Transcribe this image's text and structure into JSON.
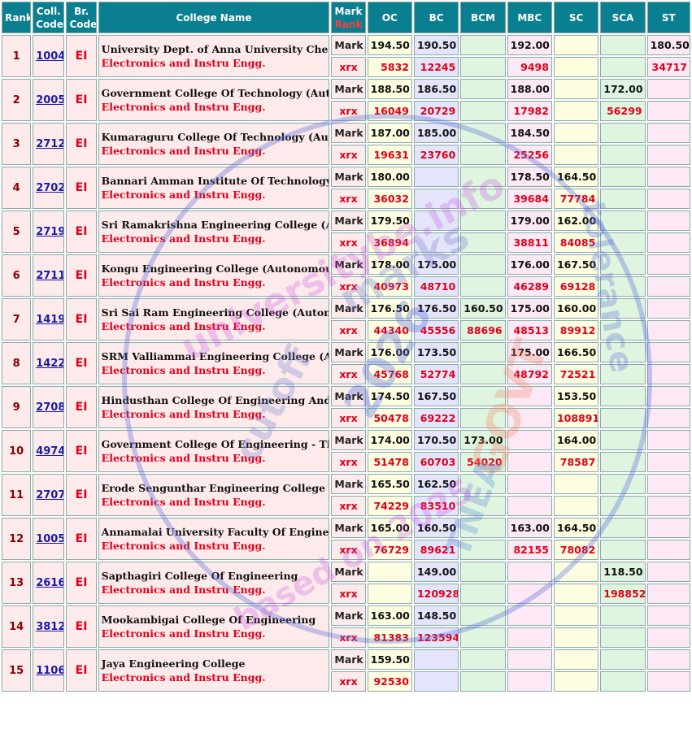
{
  "headers": {
    "rank": "Rank",
    "coll_code": "Coll. Code",
    "br_code": "Br. Code",
    "college_name": "College Name",
    "mark": "Mark",
    "mark_rank": "Rank",
    "oc": "OC",
    "bc": "BC",
    "bcm": "BCM",
    "mbc": "MBC",
    "sc": "SC",
    "sca": "SCA",
    "st": "ST"
  },
  "row_labels": {
    "mark": "Mark",
    "rank": "xrx"
  },
  "colors": {
    "header_bg": "#0a7f8f",
    "accent_red": "#e0001a",
    "link_blue": "#1a1aa8"
  },
  "watermark": {
    "line1": "universitybe.info",
    "line2": "marks",
    "line3": "cutoff",
    "line4": "2026",
    "line5": "GOVT",
    "line6": "TNEA",
    "line7": "based on 2025",
    "line8": "tolerance"
  },
  "rows": [
    {
      "rank": "1",
      "code": "1004",
      "br": "EI",
      "name": "University Dept. of Anna University Chennai - MIT Campus",
      "branch": "Electronics and Instru Engg.",
      "marks": {
        "oc": "194.50",
        "bc": "190.50",
        "bcm": "",
        "mbc": "192.00",
        "sc": "",
        "sca": "",
        "st": "180.50"
      },
      "ranks": {
        "oc": "5832",
        "bc": "12245",
        "bcm": "",
        "mbc": "9498",
        "sc": "",
        "sca": "",
        "st": "34717"
      }
    },
    {
      "rank": "2",
      "code": "2005",
      "br": "EI",
      "name": "Government College Of Technology (Autonomous)",
      "branch": "Electronics and Instru Engg.",
      "marks": {
        "oc": "188.50",
        "bc": "186.50",
        "bcm": "",
        "mbc": "188.00",
        "sc": "",
        "sca": "172.00",
        "st": ""
      },
      "ranks": {
        "oc": "16049",
        "bc": "20729",
        "bcm": "",
        "mbc": "17982",
        "sc": "",
        "sca": "56299",
        "st": ""
      }
    },
    {
      "rank": "3",
      "code": "2712",
      "br": "EI",
      "name": "Kumaraguru College Of Technology (Autonomous)",
      "branch": "Electronics and Instru Engg.",
      "marks": {
        "oc": "187.00",
        "bc": "185.00",
        "bcm": "",
        "mbc": "184.50",
        "sc": "",
        "sca": "",
        "st": ""
      },
      "ranks": {
        "oc": "19631",
        "bc": "23760",
        "bcm": "",
        "mbc": "25256",
        "sc": "",
        "sca": "",
        "st": ""
      }
    },
    {
      "rank": "4",
      "code": "2702",
      "br": "EI",
      "name": "Bannari Amman Institute Of Technology (Autonomous)",
      "branch": "Electronics and Instru Engg.",
      "marks": {
        "oc": "180.00",
        "bc": "",
        "bcm": "",
        "mbc": "178.50",
        "sc": "164.50",
        "sca": "",
        "st": ""
      },
      "ranks": {
        "oc": "36032",
        "bc": "",
        "bcm": "",
        "mbc": "39684",
        "sc": "77784",
        "sca": "",
        "st": ""
      }
    },
    {
      "rank": "5",
      "code": "2719",
      "br": "EI",
      "name": "Sri Ramakrishna Engineering College (Autonomous)",
      "branch": "Electronics and Instru Engg.",
      "marks": {
        "oc": "179.50",
        "bc": "",
        "bcm": "",
        "mbc": "179.00",
        "sc": "162.00",
        "sca": "",
        "st": ""
      },
      "ranks": {
        "oc": "36894",
        "bc": "",
        "bcm": "",
        "mbc": "38811",
        "sc": "84085",
        "sca": "",
        "st": ""
      }
    },
    {
      "rank": "6",
      "code": "2711",
      "br": "EI",
      "name": "Kongu Engineering College (Autonomous)",
      "branch": "Electronics and Instru Engg.",
      "marks": {
        "oc": "178.00",
        "bc": "175.00",
        "bcm": "",
        "mbc": "176.00",
        "sc": "167.50",
        "sca": "",
        "st": ""
      },
      "ranks": {
        "oc": "40973",
        "bc": "48710",
        "bcm": "",
        "mbc": "46289",
        "sc": "69128",
        "sca": "",
        "st": ""
      }
    },
    {
      "rank": "7",
      "code": "1419",
      "br": "EI",
      "name": "Sri Sai Ram Engineering College (Autonomous)",
      "branch": "Electronics and Instru Engg.",
      "marks": {
        "oc": "176.50",
        "bc": "176.50",
        "bcm": "160.50",
        "mbc": "175.00",
        "sc": "160.00",
        "sca": "",
        "st": ""
      },
      "ranks": {
        "oc": "44340",
        "bc": "45556",
        "bcm": "88696",
        "mbc": "48513",
        "sc": "89912",
        "sca": "",
        "st": ""
      }
    },
    {
      "rank": "8",
      "code": "1422",
      "br": "EI",
      "name": "SRM Valliammai Engineering College (Autonomous)",
      "branch": "Electronics and Instru Engg.",
      "marks": {
        "oc": "176.00",
        "bc": "173.50",
        "bcm": "",
        "mbc": "175.00",
        "sc": "166.50",
        "sca": "",
        "st": ""
      },
      "ranks": {
        "oc": "45768",
        "bc": "52774",
        "bcm": "",
        "mbc": "48792",
        "sc": "72521",
        "sca": "",
        "st": ""
      }
    },
    {
      "rank": "9",
      "code": "2708",
      "br": "EI",
      "name": "Hindusthan College Of Engineering And Technology(Autonomous)",
      "branch": "Electronics and Instru Engg.",
      "marks": {
        "oc": "174.50",
        "bc": "167.50",
        "bcm": "",
        "mbc": "",
        "sc": "153.50",
        "sca": "",
        "st": ""
      },
      "ranks": {
        "oc": "50478",
        "bc": "69222",
        "bcm": "",
        "mbc": "",
        "sc": "108891",
        "sca": "",
        "st": ""
      }
    },
    {
      "rank": "10",
      "code": "4974",
      "br": "EI",
      "name": "Government College Of Engineering - Tirunelveli",
      "branch": "Electronics and Instru Engg.",
      "marks": {
        "oc": "174.00",
        "bc": "170.50",
        "bcm": "173.00",
        "mbc": "",
        "sc": "164.00",
        "sca": "",
        "st": ""
      },
      "ranks": {
        "oc": "51478",
        "bc": "60703",
        "bcm": "54020",
        "mbc": "",
        "sc": "78587",
        "sca": "",
        "st": ""
      }
    },
    {
      "rank": "11",
      "code": "2707",
      "br": "EI",
      "name": "Erode Sengunthar Engineering College (Autonomous)",
      "branch": "Electronics and Instru Engg.",
      "marks": {
        "oc": "165.50",
        "bc": "162.50",
        "bcm": "",
        "mbc": "",
        "sc": "",
        "sca": "",
        "st": ""
      },
      "ranks": {
        "oc": "74229",
        "bc": "83510",
        "bcm": "",
        "mbc": "",
        "sc": "",
        "sca": "",
        "st": ""
      }
    },
    {
      "rank": "12",
      "code": "1005",
      "br": "EI",
      "name": "Annamalai University Faculty Of Engineering And Technology",
      "branch": "Electronics and Instru Engg.",
      "marks": {
        "oc": "165.00",
        "bc": "160.50",
        "bcm": "",
        "mbc": "163.00",
        "sc": "164.50",
        "sca": "",
        "st": ""
      },
      "ranks": {
        "oc": "76729",
        "bc": "89621",
        "bcm": "",
        "mbc": "82155",
        "sc": "78082",
        "sca": "",
        "st": ""
      }
    },
    {
      "rank": "13",
      "code": "2616",
      "br": "EI",
      "name": "Sapthagiri College Of Engineering",
      "branch": "Electronics and Instru Engg.",
      "marks": {
        "oc": "",
        "bc": "149.00",
        "bcm": "",
        "mbc": "",
        "sc": "",
        "sca": "118.50",
        "st": ""
      },
      "ranks": {
        "oc": "",
        "bc": "120928",
        "bcm": "",
        "mbc": "",
        "sc": "",
        "sca": "198852",
        "st": ""
      }
    },
    {
      "rank": "14",
      "code": "3812",
      "br": "EI",
      "name": "Mookambigai College Of Engineering",
      "branch": "Electronics and Instru Engg.",
      "marks": {
        "oc": "163.00",
        "bc": "148.50",
        "bcm": "",
        "mbc": "",
        "sc": "",
        "sca": "",
        "st": ""
      },
      "ranks": {
        "oc": "81383",
        "bc": "123594",
        "bcm": "",
        "mbc": "",
        "sc": "",
        "sca": "",
        "st": ""
      }
    },
    {
      "rank": "15",
      "code": "1106",
      "br": "EI",
      "name": "Jaya Engineering College",
      "branch": "Electronics and Instru Engg.",
      "marks": {
        "oc": "159.50",
        "bc": "",
        "bcm": "",
        "mbc": "",
        "sc": "",
        "sca": "",
        "st": ""
      },
      "ranks": {
        "oc": "92530",
        "bc": "",
        "bcm": "",
        "mbc": "",
        "sc": "",
        "sca": "",
        "st": ""
      }
    }
  ]
}
